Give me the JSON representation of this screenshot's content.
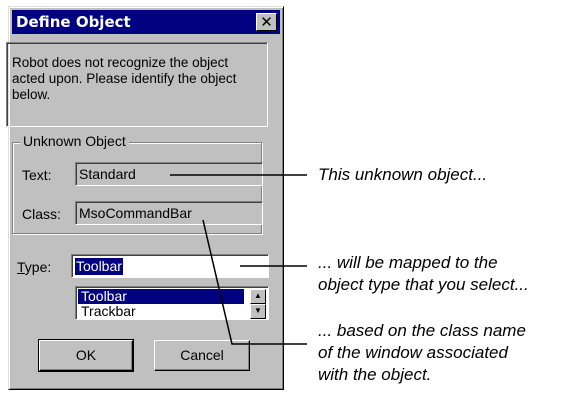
{
  "dialog": {
    "title": "Define Object",
    "close_glyph": "✕",
    "message": "Robot does not recognize the object acted upon.  Please identify the object below.",
    "group_label": "Unknown Object",
    "text_label": "Text:",
    "text_value": "Standard",
    "class_label": "Class:",
    "class_value": "MsoCommandBar",
    "type_label_accel": "T",
    "type_label_rest": "ype:",
    "type_value": "Toolbar",
    "type_options": [
      "Toolbar",
      "Trackbar"
    ],
    "selected_option": "Toolbar",
    "ok_label": "OK",
    "cancel_label": "Cancel"
  },
  "icons": {
    "close": "close-icon",
    "scroll_up": "arrow-up-icon",
    "scroll_down": "arrow-down-icon"
  },
  "annotations": {
    "a1": "This unknown object...",
    "a2_line1": "... will be mapped to the",
    "a2_line2": "object type that you select...",
    "a3_line1": "... based on the class name",
    "a3_line2": "of the window associated",
    "a3_line3": "with the object."
  },
  "colors": {
    "dialog_face": "#c0c0c0",
    "titlebar": "#000080",
    "selection": "#000080"
  }
}
